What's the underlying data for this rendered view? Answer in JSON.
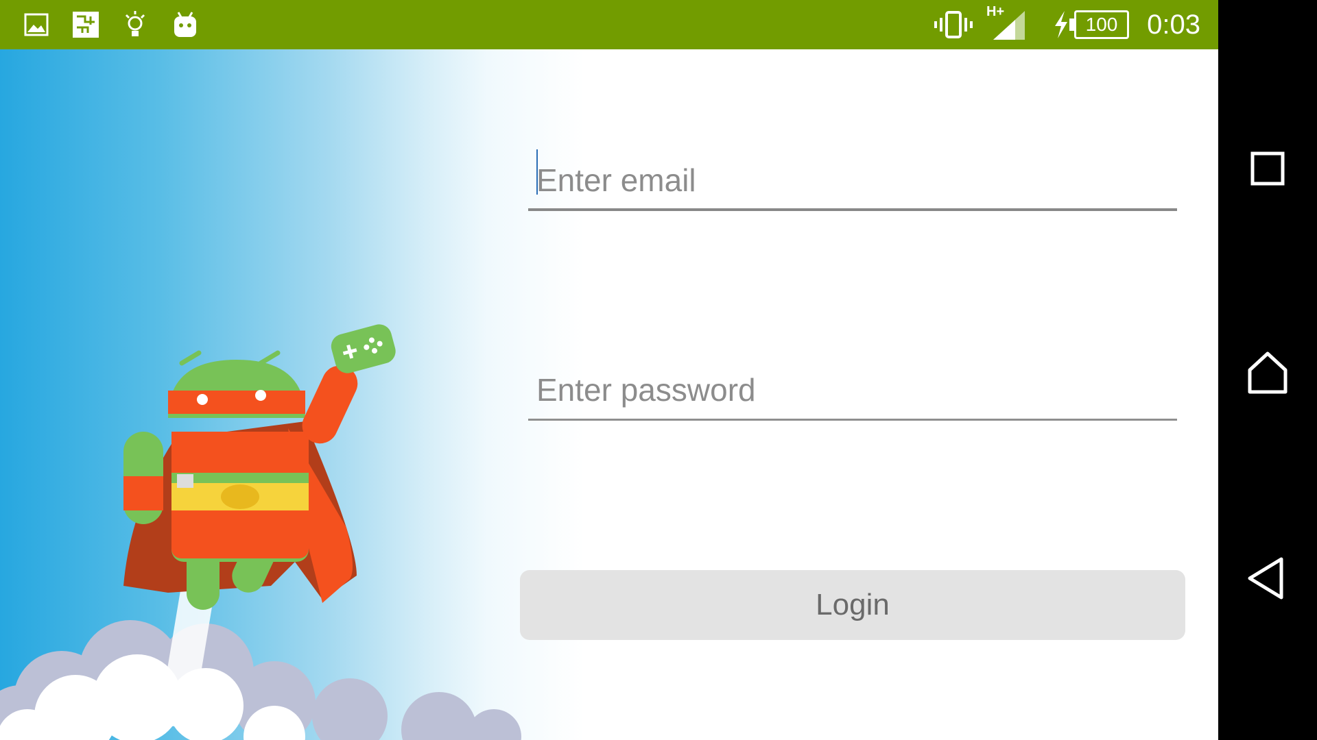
{
  "status_bar": {
    "time": "0:03",
    "battery_level": "100",
    "network_type": "H+",
    "notification_icons": [
      "image-icon",
      "chip-icon",
      "lightbulb-icon",
      "android-head-icon"
    ],
    "system_icons": [
      "vibrate-icon",
      "signal-icon",
      "charging-icon",
      "battery-icon"
    ],
    "background_color": "#729c00"
  },
  "login_form": {
    "email": {
      "placeholder": "Enter email",
      "value": ""
    },
    "password": {
      "placeholder": "Enter password",
      "value": ""
    },
    "login_button_label": "Login"
  },
  "illustration": {
    "subject": "android-superhero-with-game-controller",
    "colors": {
      "android_green": "#78c257",
      "cape_orange": "#f4511e",
      "belt_yellow": "#f6d33c",
      "sky_blue": "#27a7e0"
    }
  },
  "nav_bar": {
    "buttons": [
      "recents-icon",
      "home-icon",
      "back-icon"
    ]
  }
}
